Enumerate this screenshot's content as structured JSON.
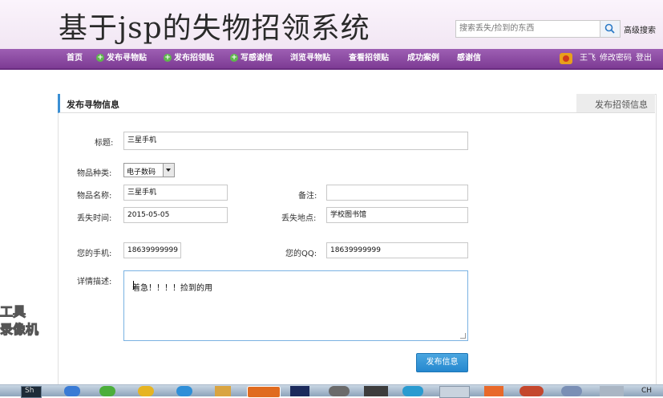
{
  "header": {
    "site_title": "基于jsp的失物招领系统",
    "search": {
      "placeholder": "搜索丢失/捡到的东西",
      "value": ""
    },
    "advanced_search_label": "高级搜索"
  },
  "nav": {
    "items": [
      {
        "label": "首页",
        "plus": false
      },
      {
        "label": "发布寻物贴",
        "plus": true
      },
      {
        "label": "发布招领贴",
        "plus": true
      },
      {
        "label": "写感谢信",
        "plus": true
      },
      {
        "label": "浏览寻物贴",
        "plus": false
      },
      {
        "label": "查看招领贴",
        "plus": false
      },
      {
        "label": "成功案例",
        "plus": false
      },
      {
        "label": "感谢信",
        "plus": false
      }
    ],
    "user": {
      "name": "王飞",
      "change_password": "修改密码",
      "logout": "登出"
    }
  },
  "panel": {
    "active_tab": "发布寻物信息",
    "other_tab": "发布招领信息"
  },
  "form": {
    "title": {
      "label": "标题:",
      "value": "三星手机"
    },
    "category": {
      "label": "物品种类:",
      "value": "电子数码"
    },
    "item_name": {
      "label": "物品名称:",
      "value": "三星手机"
    },
    "remark": {
      "label": "备注:",
      "value": ""
    },
    "lost_time": {
      "label": "丢失时间:",
      "value": "2015-05-05"
    },
    "lost_place": {
      "label": "丢失地点:",
      "value": "学校图书馆"
    },
    "phone": {
      "label": "您的手机:",
      "value": "18639999999"
    },
    "qq": {
      "label": "您的QQ:",
      "value": "18639999999"
    },
    "description": {
      "label": "详情描述:",
      "value": "着急！！！！捡到的用"
    },
    "submit_label": "发布信息"
  },
  "watermark": {
    "line1": "工具",
    "line2": "录像机"
  },
  "taskbar": {
    "left_label": "Sh",
    "clock": "CH"
  }
}
